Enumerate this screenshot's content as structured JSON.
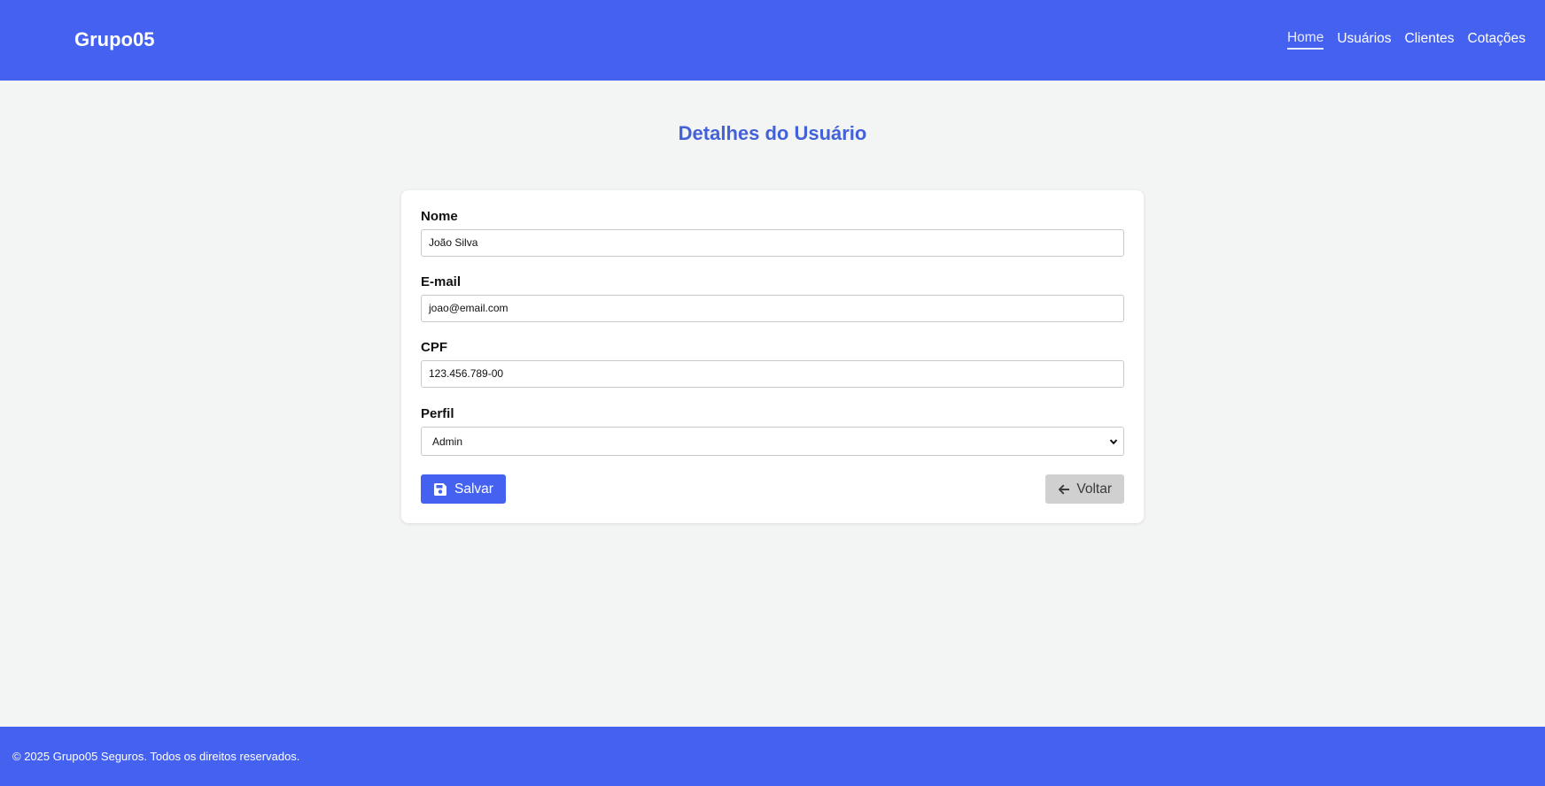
{
  "header": {
    "brand": "Grupo05",
    "nav": [
      {
        "label": "Home",
        "active": true
      },
      {
        "label": "Usuários",
        "active": false
      },
      {
        "label": "Clientes",
        "active": false
      },
      {
        "label": "Cotações",
        "active": false
      }
    ]
  },
  "main": {
    "title": "Detalhes do Usuário",
    "form": {
      "nome": {
        "label": "Nome",
        "value": "João Silva"
      },
      "email": {
        "label": "E-mail",
        "value": "joao@email.com"
      },
      "cpf": {
        "label": "CPF",
        "value": "123.456.789-00"
      },
      "perfil": {
        "label": "Perfil",
        "selected": "Admin"
      }
    },
    "buttons": {
      "save_label": "Salvar",
      "save_icon": "floppy-disk-icon",
      "back_label": "Voltar",
      "back_icon": "arrow-left-icon"
    }
  },
  "footer": {
    "text": "© 2025 Grupo05 Seguros. Todos os direitos reservados."
  },
  "colors": {
    "primary": "#4462ef",
    "title": "#4462d8",
    "background": "#f3f4f4",
    "back_button": "#d0d0d0"
  }
}
